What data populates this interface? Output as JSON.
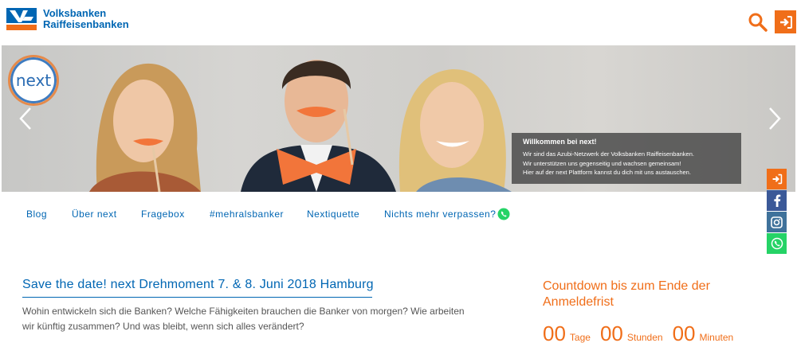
{
  "header": {
    "brand_line1": "Volksbanken",
    "brand_line2": "Raiffeisenbanken",
    "search_icon": "search-icon",
    "login_icon": "sign-in-icon"
  },
  "hero": {
    "badge_text": "next",
    "prev_icon": "chevron-left-icon",
    "next_icon": "chevron-right-icon",
    "welcome_title": "Willkommen bei next!",
    "welcome_lines": [
      "Wir sind das Azubi-Netzwerk der Volksbanken Raiffeisenbanken.",
      "Wir unterstützen uns gegenseitig und wachsen gemeinsam!",
      "Hier auf der next Plattform kannst du dich mit uns austauschen."
    ]
  },
  "nav": {
    "items": [
      {
        "label": "Blog"
      },
      {
        "label": "Über next"
      },
      {
        "label": "Fragebox"
      },
      {
        "label": "#mehralsbanker"
      },
      {
        "label": "Nextiquette"
      },
      {
        "label": "Nichts mehr verpassen?"
      }
    ],
    "whatsapp_icon": "whatsapp-icon"
  },
  "social": [
    {
      "icon": "sign-in-icon",
      "color": "#f06e19"
    },
    {
      "icon": "facebook-icon",
      "color": "#3b5998"
    },
    {
      "icon": "instagram-icon",
      "color": "#3f729b"
    },
    {
      "icon": "whatsapp-icon",
      "color": "#25d366"
    }
  ],
  "article": {
    "title": "Save the date! next Drehmoment 7. & 8. Juni 2018 Hamburg",
    "text": "Wohin entwickeln sich die Banken? Welche Fähigkeiten brauchen die Banker von morgen? Wie arbeiten wir künftig zusammen? Und was bleibt, wenn sich alles verändert?"
  },
  "countdown": {
    "title": "Countdown bis zum Ende der Anmeldefrist",
    "days_value": "00",
    "days_label": "Tage",
    "hours_value": "00",
    "hours_label": "Stunden",
    "minutes_value": "00",
    "minutes_label": "Minuten"
  },
  "colors": {
    "brand_blue": "#0066b3",
    "accent_orange": "#f06e19"
  }
}
